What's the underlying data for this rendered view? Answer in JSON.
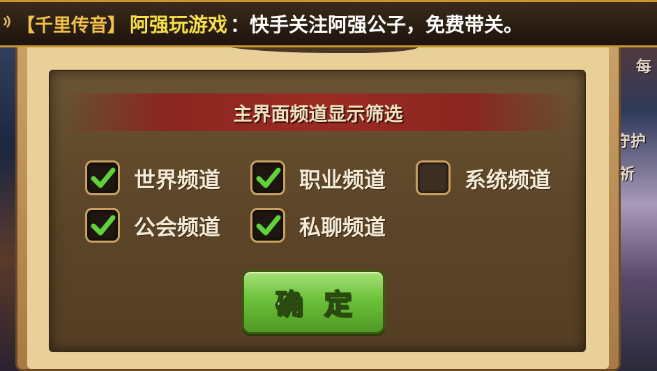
{
  "marquee": {
    "speaker_icon": "speaker-icon",
    "channel": "【千里传音】",
    "sender": "阿强玩游戏",
    "message": "：快手关注阿强公子，免费带关。"
  },
  "background_right": {
    "text_top": "每",
    "text_mid": "守护",
    "text_lower": "祈"
  },
  "dialog": {
    "title": "主界面频道显示筛选",
    "options": [
      {
        "label": "世界频道",
        "checked": true
      },
      {
        "label": "职业频道",
        "checked": true
      },
      {
        "label": "系统频道",
        "checked": false
      },
      {
        "label": "公会频道",
        "checked": true
      },
      {
        "label": "私聊频道",
        "checked": true
      }
    ],
    "confirm_label": "确定"
  },
  "colors": {
    "accent_gold": "#c8962e",
    "sender_yellow": "#f5e04a",
    "check_green": "#5fd23a",
    "banner_red": "#9b2b22",
    "button_green": "#6cc23a"
  }
}
